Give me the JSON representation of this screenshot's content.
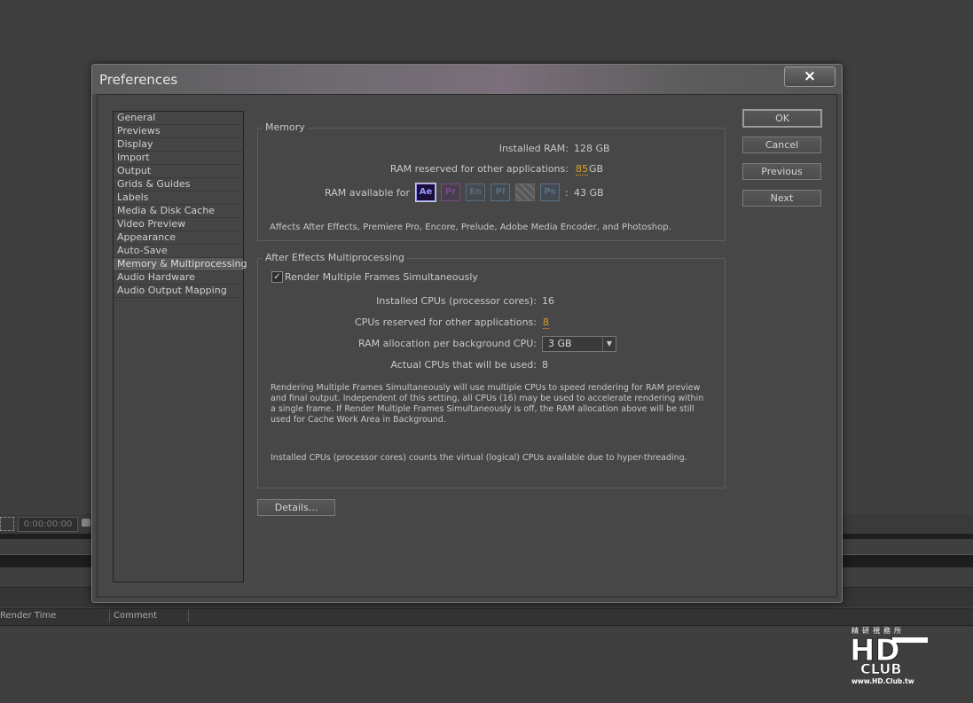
{
  "background_app": {
    "timecode": "0:00:00:00",
    "columns": [
      "Render Time",
      "Comment"
    ]
  },
  "dialog": {
    "title": "Preferences",
    "close_icon": "×",
    "sidebar": [
      {
        "label": "General"
      },
      {
        "label": "Previews"
      },
      {
        "label": "Display"
      },
      {
        "label": "Import"
      },
      {
        "label": "Output"
      },
      {
        "label": "Grids & Guides"
      },
      {
        "label": "Labels"
      },
      {
        "label": "Media & Disk Cache"
      },
      {
        "label": "Video Preview"
      },
      {
        "label": "Appearance"
      },
      {
        "label": "Auto-Save"
      },
      {
        "label": "Memory & Multiprocessing",
        "active": true
      },
      {
        "label": "Audio Hardware"
      },
      {
        "label": "Audio Output Mapping"
      }
    ],
    "memory": {
      "title": "Memory",
      "installed_ram_label": "Installed RAM:",
      "installed_ram_value": "128 GB",
      "reserved_label": "RAM reserved for other applications:",
      "reserved_value": "85",
      "reserved_unit": "GB",
      "available_label": "RAM available for",
      "apps": [
        {
          "name": "Ae",
          "color": "#9999ff",
          "bg": "#1b0f3a",
          "active": true
        },
        {
          "name": "Pr",
          "color": "#7a4a8a",
          "bg": "#4a3d4d",
          "active": false
        },
        {
          "name": "En",
          "color": "#5a6a78",
          "bg": "#434a50",
          "active": false
        },
        {
          "name": "Pl",
          "color": "#5a7080",
          "bg": "#434a50",
          "active": false
        },
        {
          "name": "Me",
          "color": "#6a6a6a",
          "bg": "#4e4e4e",
          "active": false
        },
        {
          "name": "Ps",
          "color": "#5a7088",
          "bg": "#434a52",
          "active": false
        }
      ],
      "available_sep": ":",
      "available_value": "43 GB",
      "note": "Affects After Effects, Premiere Pro, Encore, Prelude, Adobe Media Encoder, and Photoshop."
    },
    "multiprocessing": {
      "title": "After Effects Multiprocessing",
      "render_multiple_label": "Render Multiple Frames Simultaneously",
      "render_multiple_checked": true,
      "installed_cpus_label": "Installed CPUs (processor cores):",
      "installed_cpus_value": "16",
      "cpus_reserved_label": "CPUs reserved for other applications:",
      "cpus_reserved_value": "8",
      "ram_per_cpu_label": "RAM allocation per background CPU:",
      "ram_per_cpu_value": "3 GB",
      "actual_cpus_label": "Actual CPUs that will be used:",
      "actual_cpus_value": "8",
      "note1": "Rendering Multiple Frames Simultaneously will use multiple CPUs to speed rendering for RAM preview and final output. Independent of this setting, all CPUs (16) may be used to accelerate rendering within a single frame. If Render Multiple Frames Simultaneously is off, the RAM allocation above will be still used for Cache Work Area in Background.",
      "note2": "Installed CPUs (processor cores) counts the virtual (logical) CPUs available due to hyper-threading."
    },
    "details_button": "Details...",
    "buttons": {
      "ok": "OK",
      "cancel": "Cancel",
      "previous": "Previous",
      "next": "Next"
    }
  },
  "watermark": {
    "line1": "精研視務所",
    "line2": "HD",
    "line3": "CLUB",
    "line4": "www.HD.Club.tw"
  }
}
